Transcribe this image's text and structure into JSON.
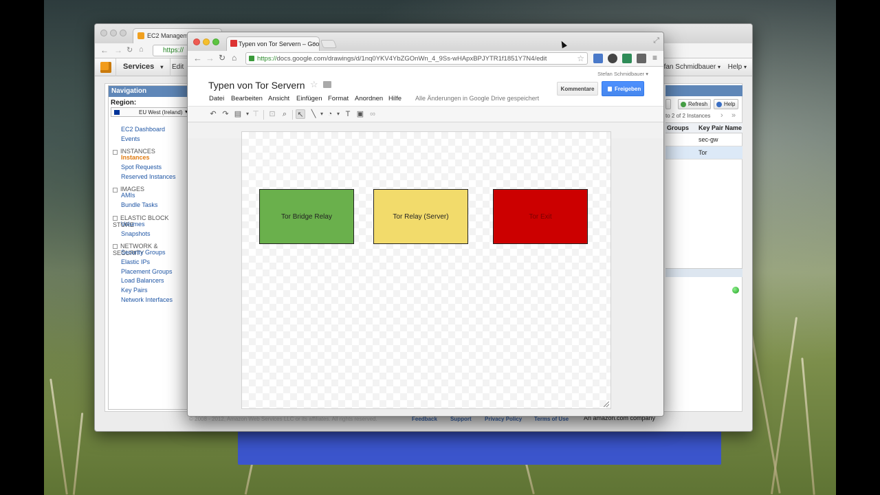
{
  "aws_window": {
    "tab_title": "EC2 Management",
    "url_fragment": "https://",
    "menu": {
      "services_label": "Services",
      "edit_label": "Edit",
      "user_label": "Stefan Schmidbauer",
      "help_label": "Help"
    },
    "navigation": {
      "header": "Navigation",
      "region_label": "Region:",
      "region_value": "EU West (Ireland)",
      "top_items": [
        "EC2 Dashboard",
        "Events"
      ],
      "groups": [
        {
          "title": "INSTANCES",
          "items": [
            "Instances",
            "Spot Requests",
            "Reserved Instances"
          ],
          "active_index": 0
        },
        {
          "title": "IMAGES",
          "items": [
            "AMIs",
            "Bundle Tasks"
          ]
        },
        {
          "title": "ELASTIC BLOCK STORE",
          "items": [
            "Volumes",
            "Snapshots"
          ]
        },
        {
          "title": "NETWORK & SECURITY",
          "items": [
            "Security Groups",
            "Elastic IPs",
            "Placement Groups",
            "Load Balancers",
            "Key Pairs",
            "Network Interfaces"
          ]
        }
      ]
    },
    "instances_panel": {
      "refresh_label": "Refresh",
      "help_label": "Help",
      "pager_text": "to 2 of 2 Instances",
      "columns": [
        "Groups",
        "Key Pair Name"
      ],
      "rows": [
        {
          "key_pair": "sec-gw"
        },
        {
          "key_pair": "Tor"
        }
      ]
    },
    "footer": {
      "copyright": "© 2008 - 2012, Amazon Web Services LLC or its affiliates. All rights reserved.",
      "links": [
        "Feedback",
        "Support",
        "Privacy Policy",
        "Terms of Use"
      ],
      "company": "An amazon.com company"
    }
  },
  "drawing_window": {
    "tab_title": "Typen von Tor Servern – Goo",
    "url_https": "https://",
    "url_rest": "docs.google.com/drawings/d/1nq0YKV4YbZGOnWn_4_9Ss-wHApxBPJYTR1f1851Y7N4/edit",
    "user_name": "Stefan Schmidbauer",
    "doc_title": "Typen von Tor Servern",
    "menu_items": [
      "Datei",
      "Bearbeiten",
      "Ansicht",
      "Einfügen",
      "Format",
      "Anordnen",
      "Hilfe"
    ],
    "save_status": "Alle Änderungen in Google Drive gespeichert",
    "comments_label": "Kommentare",
    "share_label": "Freigeben",
    "shapes": [
      {
        "label": "Tor Bridge Relay",
        "fill": "#6ab04c",
        "text_color": "#222222"
      },
      {
        "label": "Tor Relay (Server)",
        "fill": "#f2db6b",
        "text_color": "#222222"
      },
      {
        "label": "Tor Exit",
        "fill": "#cc0000",
        "text_color": "#7a0000"
      }
    ]
  },
  "colors": {
    "share_blue": "#4d90fe",
    "aws_nav_blue": "#5f87b8",
    "aws_orange": "#f19b1b",
    "dock_blue": "#3b55cc"
  }
}
